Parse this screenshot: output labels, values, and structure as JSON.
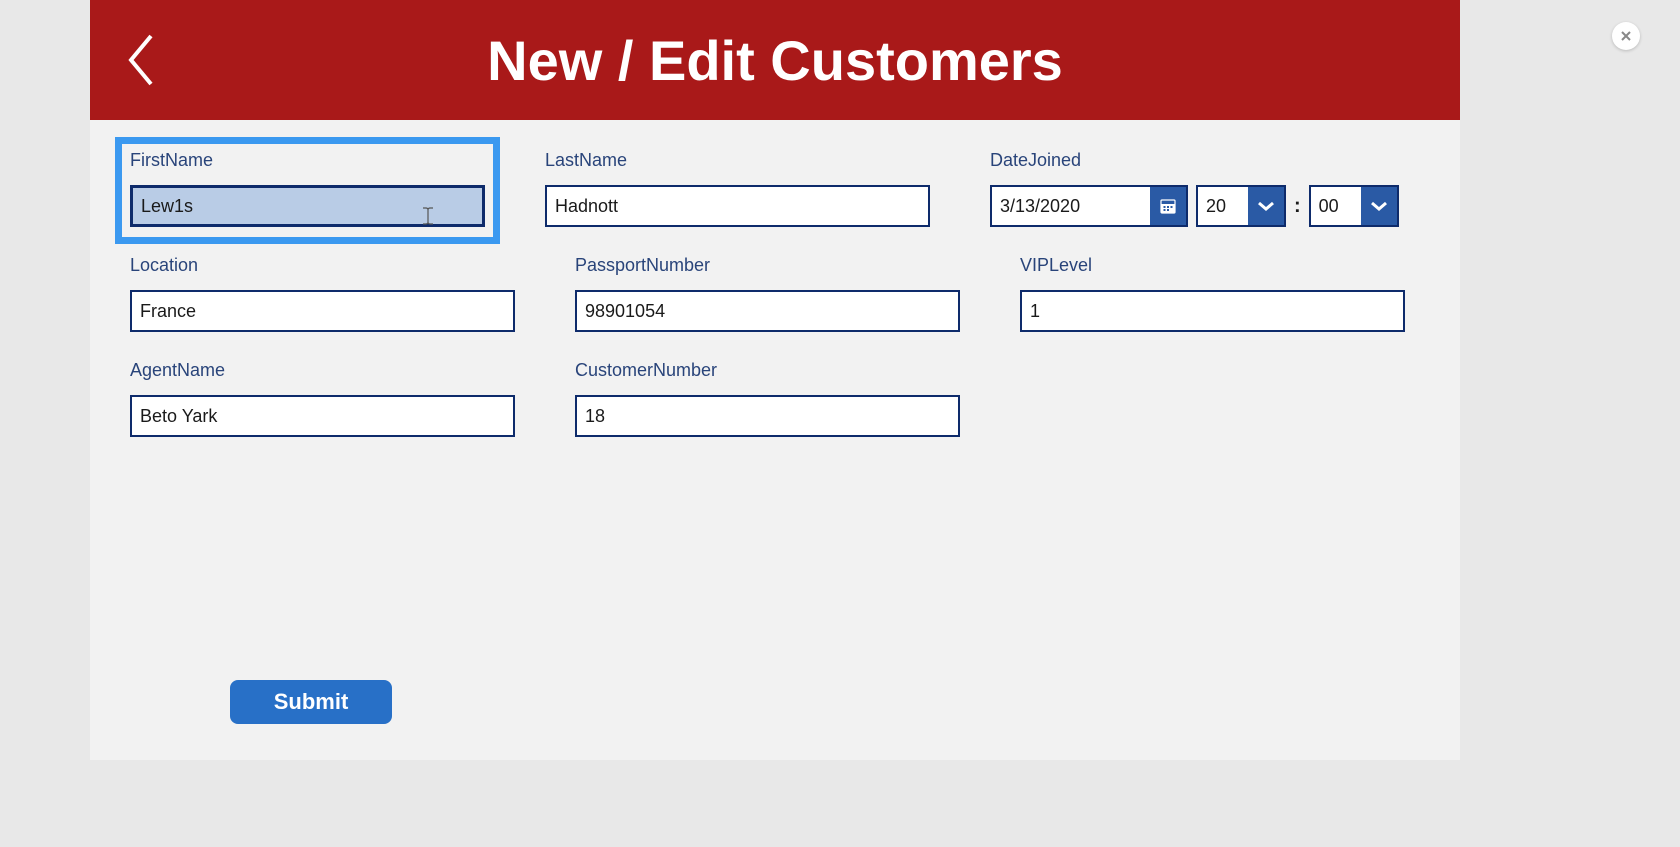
{
  "header": {
    "title": "New / Edit Customers"
  },
  "fields": {
    "firstName": {
      "label": "FirstName",
      "value": "Lew1s"
    },
    "lastName": {
      "label": "LastName",
      "value": "Hadnott"
    },
    "dateJoined": {
      "label": "DateJoined",
      "date": "3/13/2020",
      "hour": "20",
      "minute": "00"
    },
    "location": {
      "label": "Location",
      "value": "France"
    },
    "passportNumber": {
      "label": "PassportNumber",
      "value": "98901054"
    },
    "vipLevel": {
      "label": "VIPLevel",
      "value": "1"
    },
    "agentName": {
      "label": "AgentName",
      "value": "Beto Yark"
    },
    "customerNumber": {
      "label": "CustomerNumber",
      "value": "18"
    }
  },
  "actions": {
    "submit": "Submit"
  },
  "timeSeparator": ":"
}
